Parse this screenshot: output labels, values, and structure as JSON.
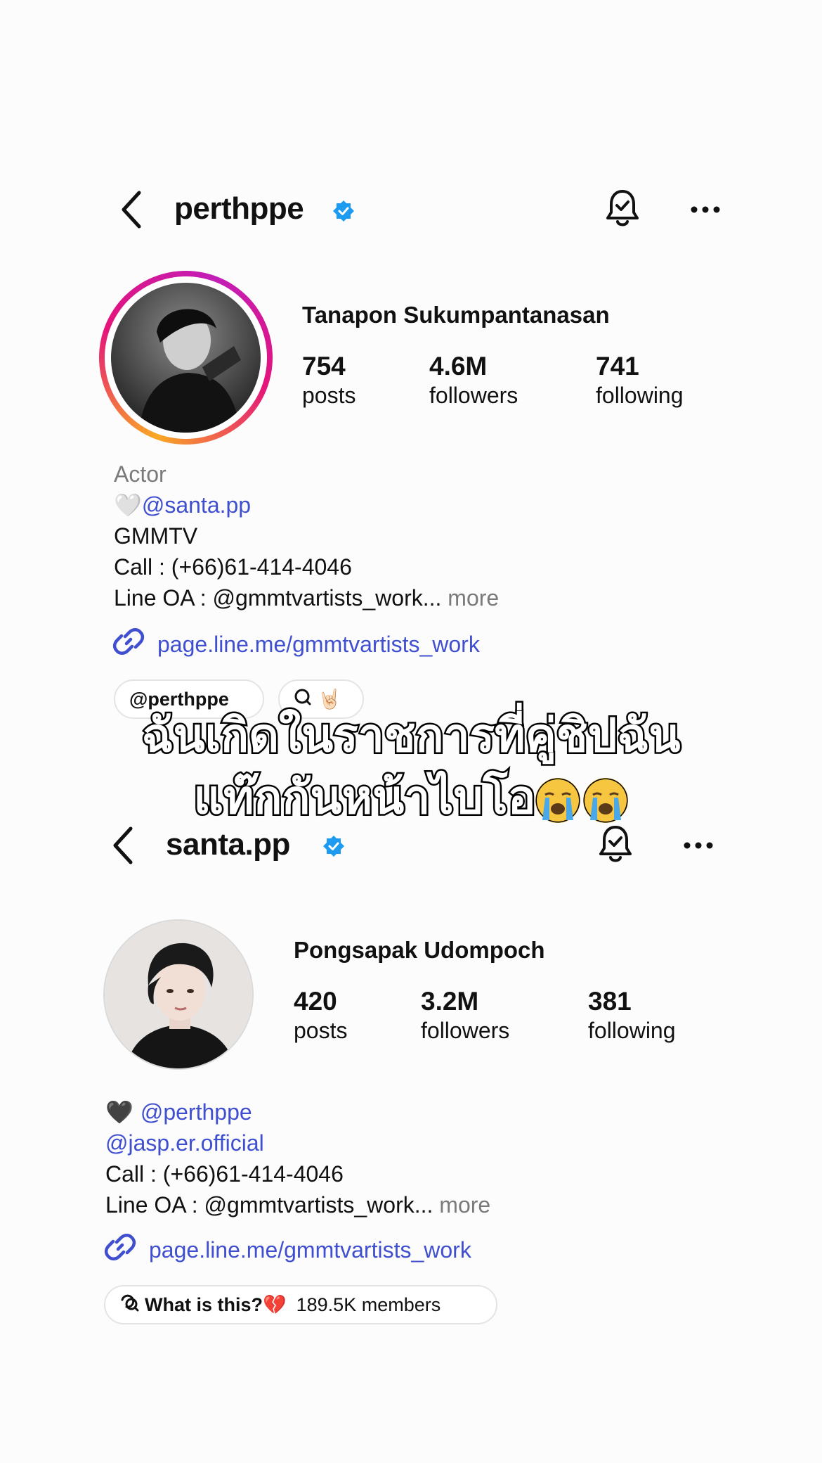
{
  "profile1": {
    "username": "perthppe",
    "full_name": "Tanapon Sukumpantanasan",
    "stats": [
      {
        "num": "754",
        "label": "posts"
      },
      {
        "num": "4.6M",
        "label": "followers"
      },
      {
        "num": "741",
        "label": "following"
      }
    ],
    "bio": {
      "category": "Actor",
      "heart": "🤍",
      "mention": "@santa.pp",
      "line2": "GMMTV",
      "line3": "Call : (+66)61-414-4046",
      "line4": "Line OA : @gmmtvartists_work...",
      "more": "more"
    },
    "link": "page.line.me/gmmtvartists_work",
    "pills": [
      "@perthppe",
      "🤘🏻"
    ]
  },
  "overlay": {
    "line1": "ฉันเกิดในราชการที่คู่ชิปฉัน",
    "line2": "แท๊กกันหน้าไบโอ"
  },
  "profile2": {
    "username": "santa.pp",
    "full_name": "Pongsapak Udompoch",
    "stats": [
      {
        "num": "420",
        "label": "posts"
      },
      {
        "num": "3.2M",
        "label": "followers"
      },
      {
        "num": "381",
        "label": "following"
      }
    ],
    "bio": {
      "heart": "🖤",
      "mention": "@perthppe",
      "line2": "@jasp.er.official",
      "line3": "Call : (+66)61-414-4046",
      "line4": "Line OA : @gmmtvartists_work...",
      "more": "more"
    },
    "link": "page.line.me/gmmtvartists_work",
    "community": {
      "title": "What is this?💔",
      "members": "189.5K members"
    }
  },
  "colors": {
    "link_blue": "#3f4fd0",
    "verified_blue": "#1d9bf0",
    "story_ring_start": "#f9a825",
    "story_ring_end": "#e4147a"
  },
  "icons": [
    "back-icon",
    "verified-icon",
    "bell-icon",
    "more-icon",
    "link-icon",
    "threads-icon",
    "crying-emoji-icon"
  ]
}
